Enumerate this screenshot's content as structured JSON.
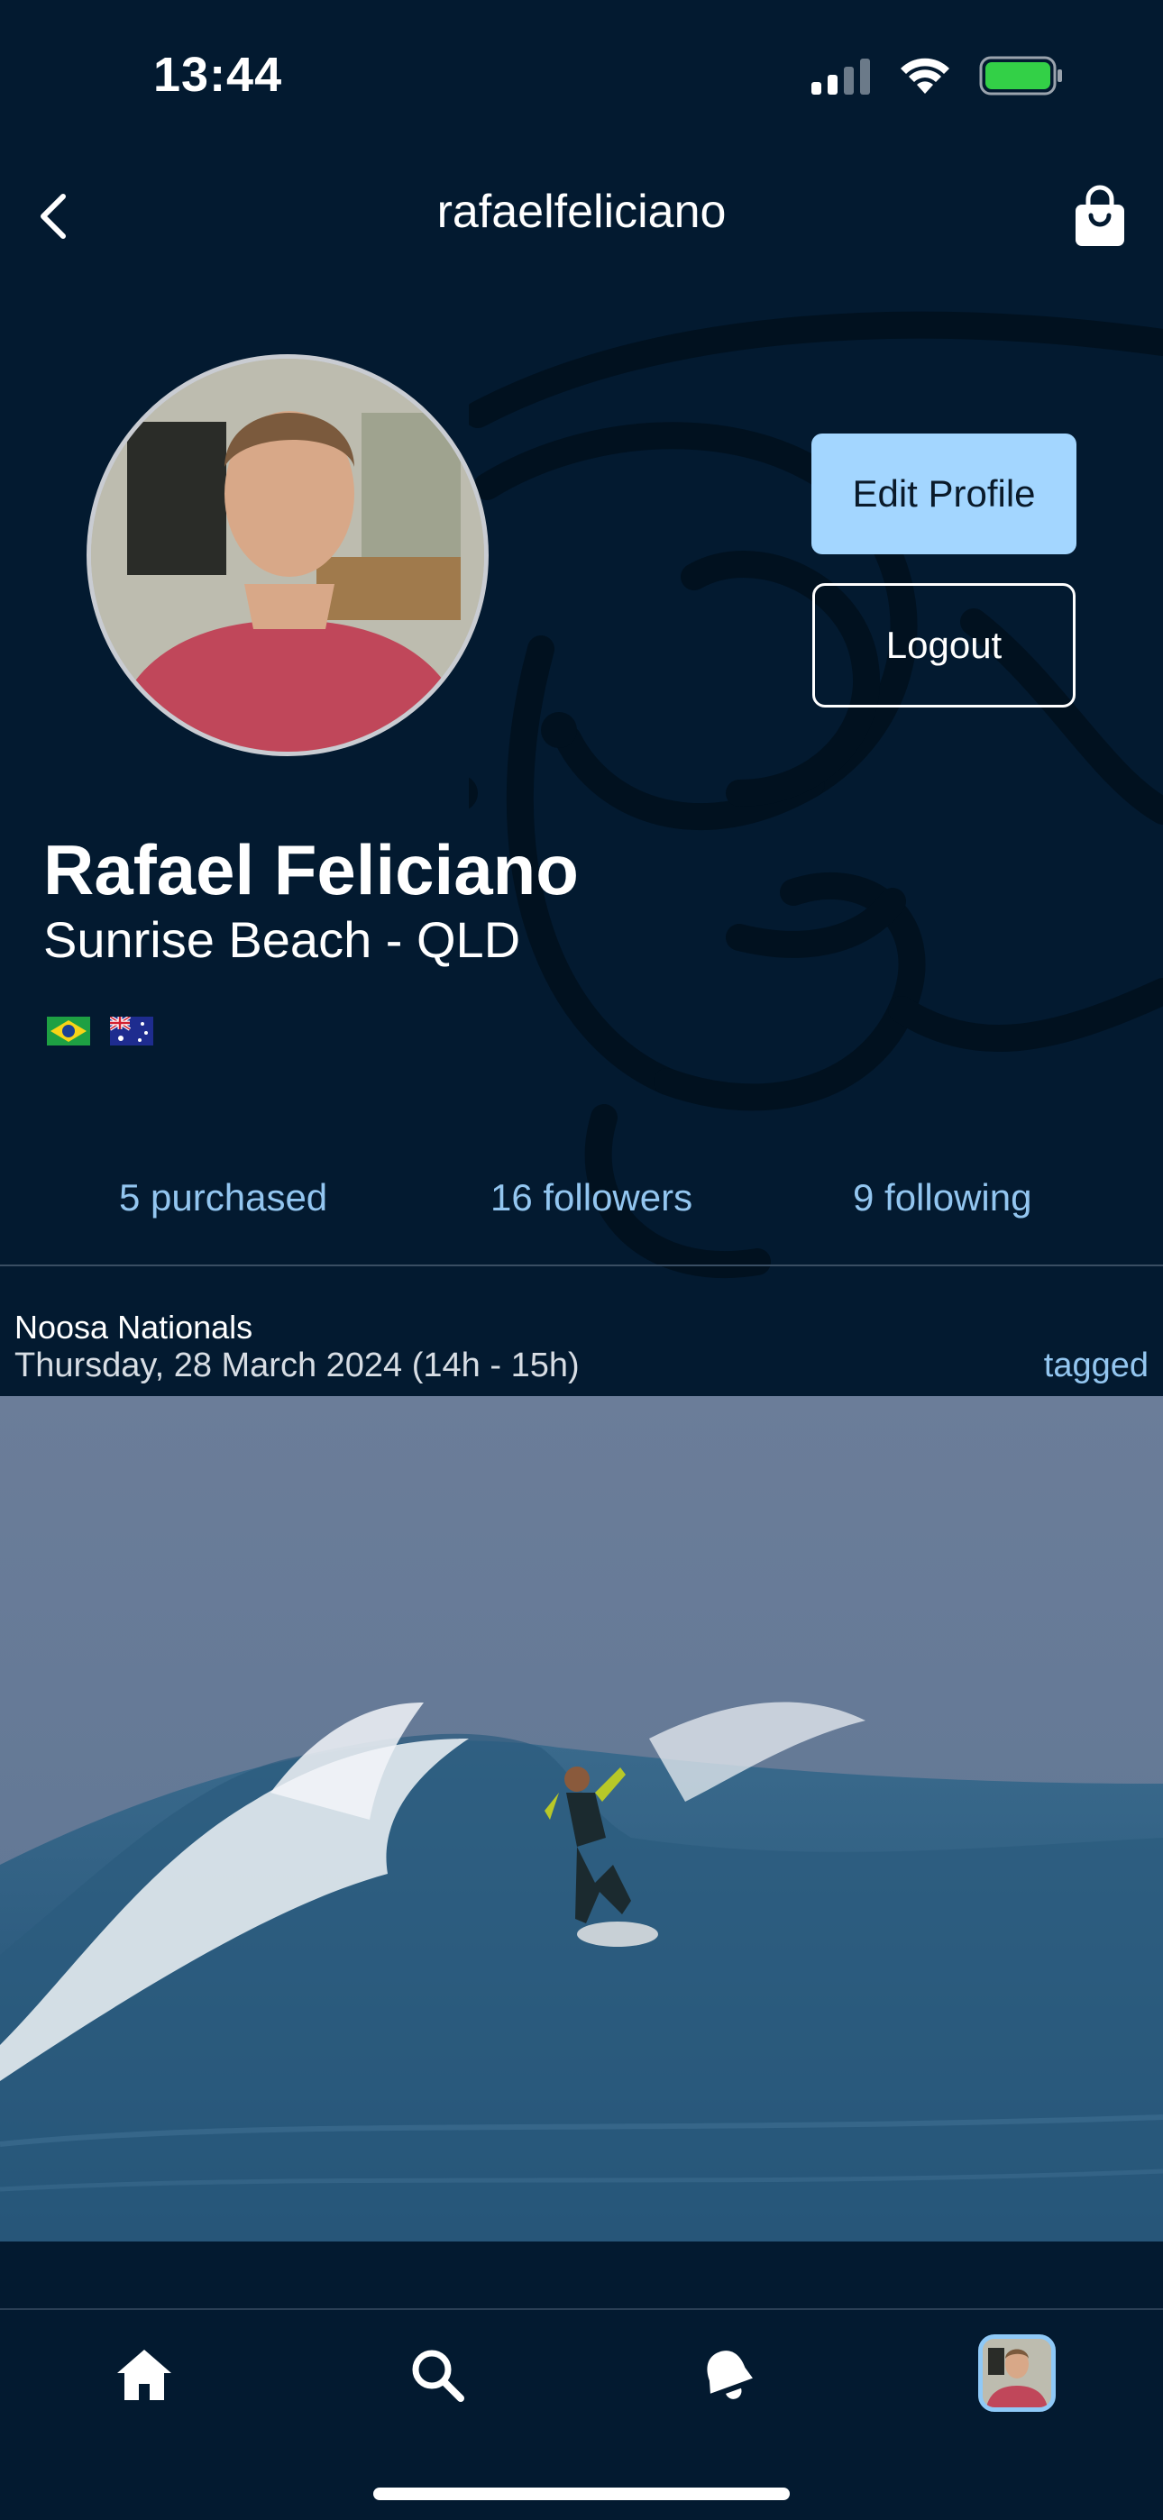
{
  "status_bar": {
    "time": "13:44"
  },
  "nav": {
    "title": "rafaelfeliciano"
  },
  "profile": {
    "name": "Rafael Feliciano",
    "location": "Sunrise Beach - QLD",
    "flags": [
      "Brazil flag",
      "Australia flag"
    ],
    "edit_label": "Edit Profile",
    "logout_label": "Logout"
  },
  "stats": {
    "purchased": "5 purchased",
    "followers": "16 followers",
    "following": "9 following"
  },
  "post": {
    "event": "Noosa Nationals",
    "date": "Thursday, 28 March 2024 (14h - 15h)",
    "tag": "tagged"
  },
  "colors": {
    "background": "#031a30",
    "accent": "#a3d6ff",
    "link": "#93c6f0"
  }
}
